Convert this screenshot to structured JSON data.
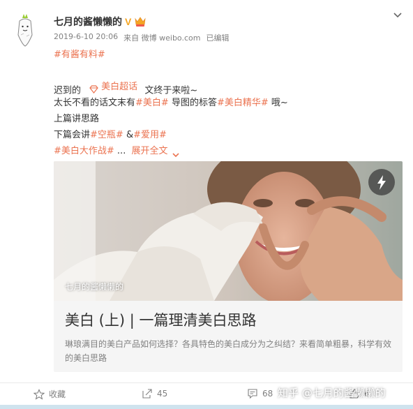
{
  "author": {
    "name": "七月的酱懒懒的",
    "v_badge": "V"
  },
  "meta": {
    "datetime": "2019-6-10 20:06",
    "source": "来自 微博 weibo.com",
    "edited": "已编辑"
  },
  "post": {
    "line1_tag": "#有酱有料#",
    "line2_prefix": "迟到的",
    "line2_chip": "美白超话",
    "line2_suffix": "文终于来啦~",
    "line3_a": "太长不看的话文末有",
    "line3_tag1": "#美白#",
    "line3_b": " 导图的标答",
    "line3_tag2": "#美白精华#",
    "line3_c": " 哦~",
    "line4": "上篇讲思路",
    "line5_a": "下篇会讲",
    "line5_tag1": "#空瓶#",
    "line5_amp": " &",
    "line5_tag2": "#爱用#",
    "line6_tag": "#美白大作战#",
    "line6_ellipsis": " ...",
    "expand_label": "展开全文"
  },
  "card": {
    "watermark": "七月的酱懒懒的",
    "title": "美白 (上) | 一篇理清美白思路",
    "description": "琳琅满目的美白产品如何选择？各具特色的美白成分为之纠结？来看简单粗暴，科学有效的美白思路"
  },
  "actions": [
    {
      "label": "收藏",
      "icon": "star-icon"
    },
    {
      "label": "45",
      "icon": "share-icon"
    },
    {
      "label": "68",
      "icon": "comment-icon"
    },
    {
      "label": "6",
      "icon": "like-icon"
    }
  ],
  "overlay": {
    "zhihu_watermark": "知乎 @七月的酱懒懒的"
  },
  "colors": {
    "tag": "#eb7350",
    "meta": "#808080",
    "text": "#333333",
    "v_badge": "#f5a623"
  }
}
